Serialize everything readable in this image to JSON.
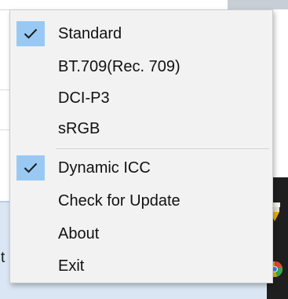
{
  "background": {
    "partial_text": "t"
  },
  "menu": {
    "check_color": "#99c9f2",
    "items": [
      {
        "label": "Standard",
        "checked": true
      },
      {
        "label": "BT.709(Rec. 709)",
        "checked": false
      },
      {
        "label": "DCI-P3",
        "checked": false
      },
      {
        "label": "sRGB",
        "checked": false
      },
      {
        "label": "Dynamic ICC",
        "checked": true
      },
      {
        "label": "Check for Update",
        "checked": false
      },
      {
        "label": "About",
        "checked": false
      },
      {
        "label": "Exit",
        "checked": false
      }
    ]
  }
}
